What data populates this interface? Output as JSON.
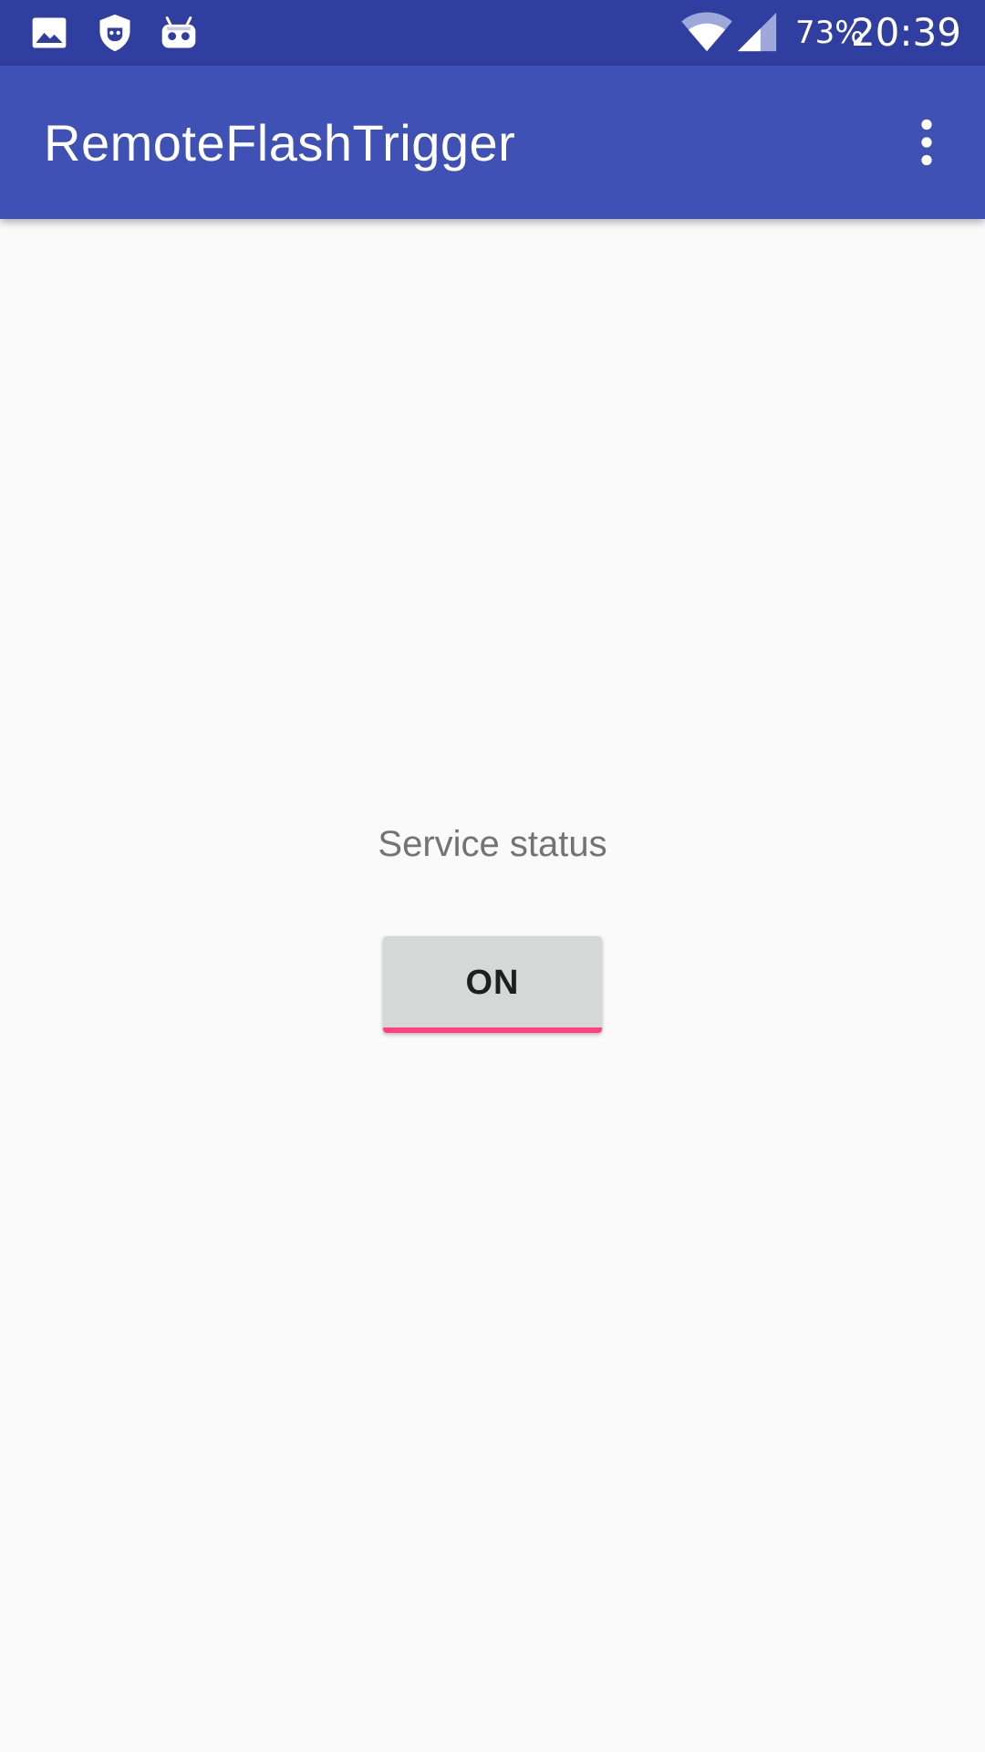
{
  "status_bar": {
    "battery_percent": "73%",
    "clock": "20:39",
    "icons": {
      "left": [
        "image-icon",
        "shield-face-icon",
        "robot-icon"
      ],
      "right": [
        "wifi-icon",
        "cell-signal-icon"
      ]
    }
  },
  "app_bar": {
    "title": "RemoteFlashTrigger",
    "menu_icon": "more-vert-icon"
  },
  "main": {
    "status_label": "Service status",
    "toggle": {
      "label": "ON",
      "indicator_color": "#ff4081"
    }
  },
  "colors": {
    "status_bar": "#303f9f",
    "app_bar": "#3f51b5",
    "background": "#fafafa",
    "button_bg": "#d6d7d7",
    "accent": "#ff4081"
  }
}
